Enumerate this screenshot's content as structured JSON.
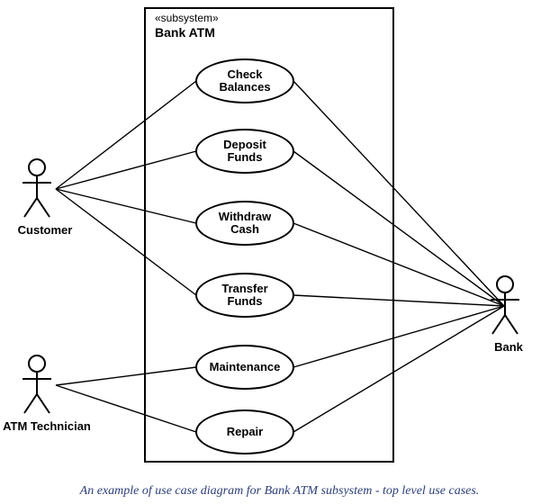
{
  "diagram_type": "UML Use Case Diagram",
  "subsystem": {
    "stereotype": "«subsystem»",
    "name": "Bank ATM"
  },
  "actors": {
    "customer": {
      "label": "Customer"
    },
    "technician": {
      "label": "ATM Technician"
    },
    "bank": {
      "label": "Bank"
    }
  },
  "use_cases": {
    "check_balances": {
      "label": "Check\nBalances"
    },
    "deposit_funds": {
      "label": "Deposit\nFunds"
    },
    "withdraw_cash": {
      "label": "Withdraw\nCash"
    },
    "transfer_funds": {
      "label": "Transfer\nFunds"
    },
    "maintenance": {
      "label": "Maintenance"
    },
    "repair": {
      "label": "Repair"
    }
  },
  "associations": [
    {
      "from": "customer",
      "to": "check_balances"
    },
    {
      "from": "customer",
      "to": "deposit_funds"
    },
    {
      "from": "customer",
      "to": "withdraw_cash"
    },
    {
      "from": "customer",
      "to": "transfer_funds"
    },
    {
      "from": "technician",
      "to": "maintenance"
    },
    {
      "from": "technician",
      "to": "repair"
    },
    {
      "from": "bank",
      "to": "check_balances"
    },
    {
      "from": "bank",
      "to": "deposit_funds"
    },
    {
      "from": "bank",
      "to": "withdraw_cash"
    },
    {
      "from": "bank",
      "to": "transfer_funds"
    },
    {
      "from": "bank",
      "to": "maintenance"
    },
    {
      "from": "bank",
      "to": "repair"
    }
  ],
  "caption": "An example of use case diagram for Bank ATM subsystem - top level use cases."
}
